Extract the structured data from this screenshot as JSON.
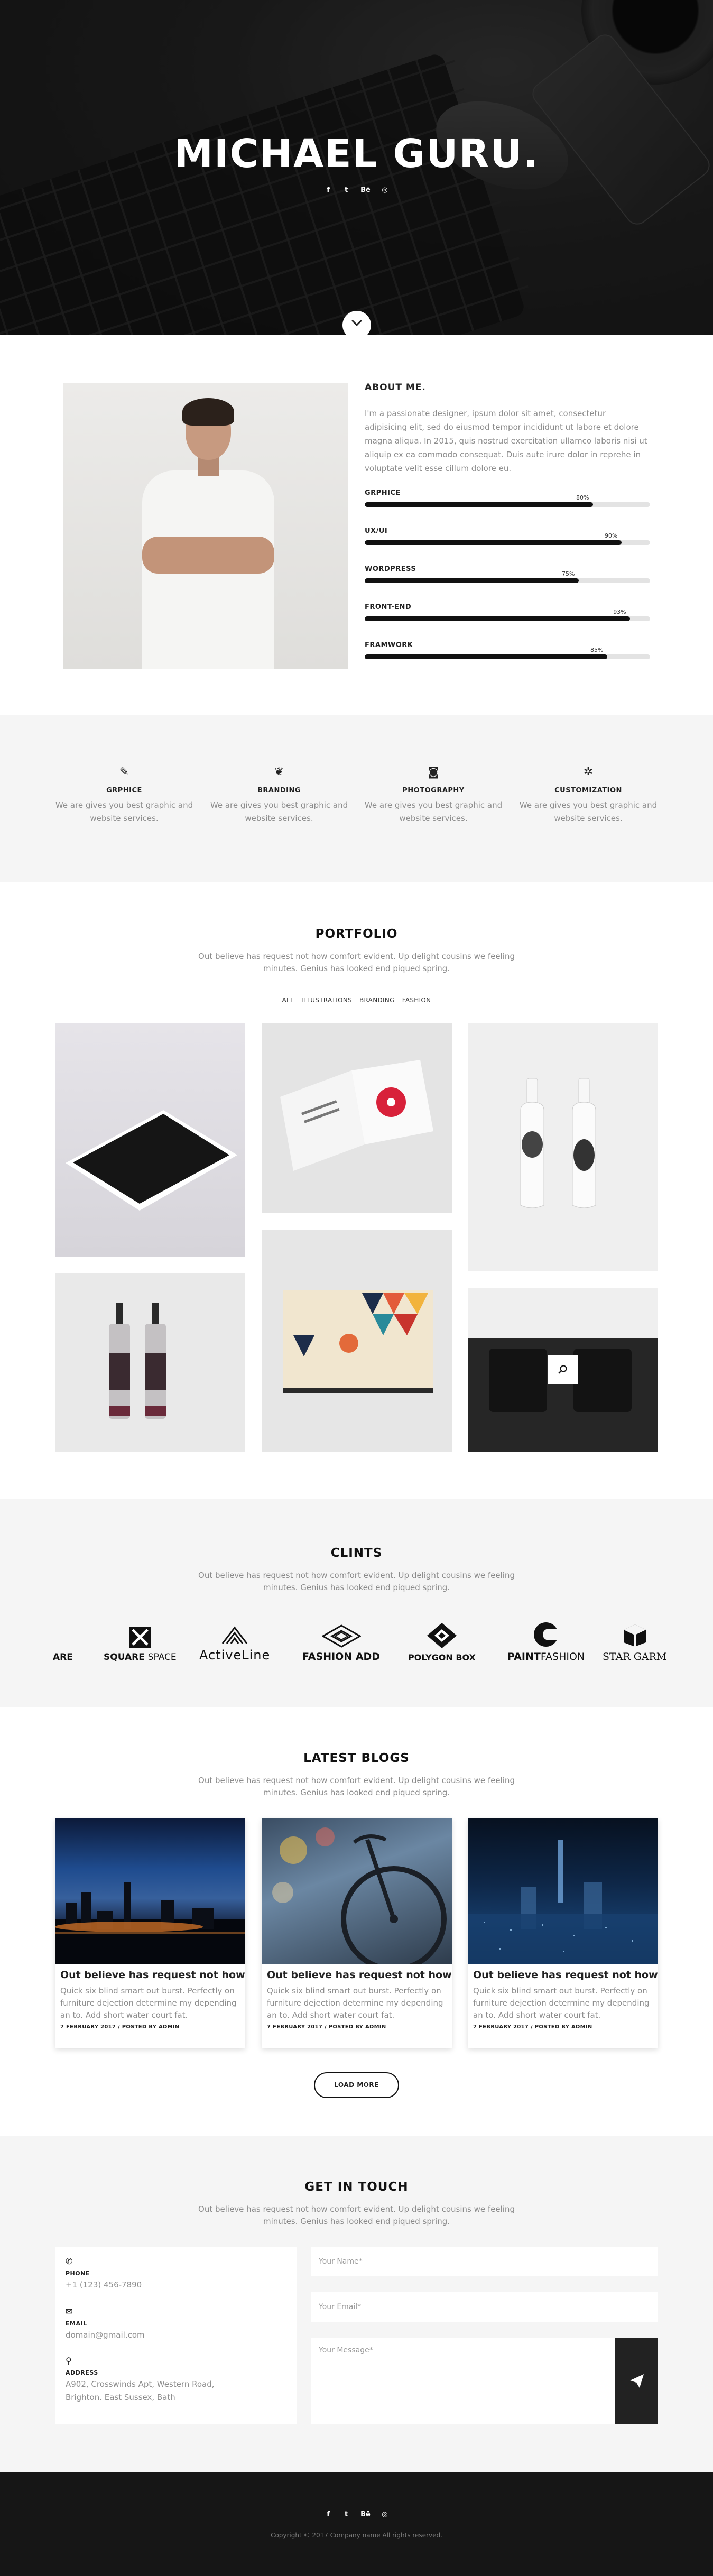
{
  "hero": {
    "title": "MICHAEL GURU.",
    "social": [
      "f",
      "t",
      "Bē",
      "◎"
    ],
    "social_icons": [
      "facebook-icon",
      "twitter-icon",
      "behance-icon",
      "dribbble-icon"
    ]
  },
  "about": {
    "title": "ABOUT ME.",
    "text": "I'm a passionate designer, ipsum dolor sit amet, consectetur adipisicing elit, sed do eiusmod tempor incididunt ut labore et dolore magna aliqua. In 2015, quis nostrud exercitation ullamco laboris nisi ut aliquip ex ea commodo consequat. Duis aute irure dolor in reprehe in voluptate velit esse cillum dolore eu.",
    "skills": [
      {
        "name": "GRPHICE",
        "percent_label": "80%",
        "value": 80
      },
      {
        "name": "UX/UI",
        "percent_label": "90%",
        "value": 90
      },
      {
        "name": "WORDPRESS",
        "percent_label": "75%",
        "value": 75
      },
      {
        "name": "FRONT-END",
        "percent_label": "93%",
        "value": 93
      },
      {
        "name": "FRAMWORK",
        "percent_label": "85%",
        "value": 85
      }
    ]
  },
  "services": [
    {
      "icon": "magic-wand-icon",
      "glyph": "✎",
      "title": "GRPHICE",
      "desc": "We are gives you best graphic and website services."
    },
    {
      "icon": "leaf-icon",
      "glyph": "❦",
      "title": "BRANDING",
      "desc": "We are gives you best graphic and website services."
    },
    {
      "icon": "camera-icon",
      "glyph": "◙",
      "title": "PHOTOGRAPHY",
      "desc": "We are gives you best graphic and website services."
    },
    {
      "icon": "gear-icon",
      "glyph": "✲",
      "title": "CUSTOMIZATION",
      "desc": "We are gives you best graphic and website services."
    }
  ],
  "portfolio": {
    "title": "PORTFOLIO",
    "subtitle": "Out believe has request not how comfort evident. Up delight cousins we feeling minutes. Genius has looked end piqued spring.",
    "filters": [
      "ALL",
      "ILLUSTRATIONS",
      "BRANDING",
      "FASHION"
    ]
  },
  "clients": {
    "title": "CLINTS",
    "subtitle": "Out believe has request not how comfort evident. Up delight cousins we feeling minutes. Genius has looked end piqued spring.",
    "logos": [
      "ARE",
      "SQUARE",
      "SPACE",
      "ActiveLine",
      "FASHION ADD",
      "POLYGON BOX",
      "PAINT",
      "FASHION",
      "STAR GARM"
    ]
  },
  "blogs": {
    "title": "LATEST BLOGS",
    "subtitle": "Out believe has request not how comfort evident. Up delight cousins we feeling minutes. Genius has looked end piqued spring.",
    "posts": [
      {
        "title": "Out believe has request not how",
        "excerpt": "Quick six blind smart out burst. Perfectly on furniture dejection determine my depending an to. Add short water court fat.",
        "meta": "7 FEBRUARY 2017 / POSTED BY ADMIN"
      },
      {
        "title": "Out believe has request not how",
        "excerpt": "Quick six blind smart out burst. Perfectly on furniture dejection determine my depending an to. Add short water court fat.",
        "meta": "7 FEBRUARY 2017 / POSTED BY ADMIN"
      },
      {
        "title": "Out believe has request not how",
        "excerpt": "Quick six blind smart out burst. Perfectly on furniture dejection determine my depending an to. Add short water court fat.",
        "meta": "7 FEBRUARY 2017 / POSTED BY ADMIN"
      }
    ],
    "load_more": "LOAD MORE"
  },
  "contact": {
    "title": "GET IN TOUCH",
    "subtitle": "Out believe has request not how comfort evident. Up delight cousins we feeling minutes. Genius has looked end piqued spring.",
    "phone_label": "PHONE",
    "phone": "+1 (123) 456-7890",
    "email_label": "EMAIL",
    "email": "domain@gmail.com",
    "address_label": "ADDRESS",
    "address": "A902, Crosswinds Apt, Western Road, Brighton. East Sussex, Bath",
    "name_placeholder": "Your Name*",
    "email_placeholder": "Your Email*",
    "message_placeholder": "Your Message*"
  },
  "footer": {
    "social": [
      "f",
      "t",
      "Bē",
      "◎"
    ],
    "copyright": "Copyright © 2017 Company name All rights reserved."
  }
}
